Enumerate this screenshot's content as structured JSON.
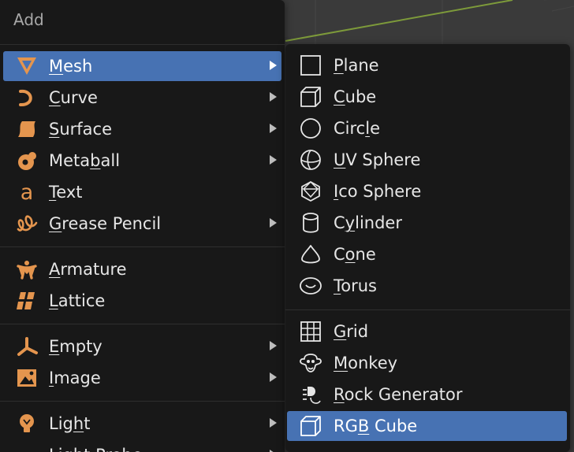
{
  "add_menu": {
    "title": "Add",
    "items": [
      {
        "label": "Mesh",
        "mnemonic": "M",
        "icon": "mesh-icon",
        "submenu": true,
        "active": true
      },
      {
        "label": "Curve",
        "mnemonic": "C",
        "icon": "curve-icon",
        "submenu": true
      },
      {
        "label": "Surface",
        "mnemonic": "S",
        "icon": "surface-icon",
        "submenu": true
      },
      {
        "label": "Metaball",
        "mnemonic": "b",
        "icon": "metaball-icon",
        "submenu": true
      },
      {
        "label": "Text",
        "mnemonic": "T",
        "icon": "text-icon",
        "submenu": false
      },
      {
        "label": "Grease Pencil",
        "mnemonic": "G",
        "icon": "grease-pencil-icon",
        "submenu": true
      },
      {
        "label": "Armature",
        "mnemonic": "A",
        "icon": "armature-icon",
        "submenu": false
      },
      {
        "label": "Lattice",
        "mnemonic": "L",
        "icon": "lattice-icon",
        "submenu": false
      },
      {
        "label": "Empty",
        "mnemonic": "E",
        "icon": "empty-icon",
        "submenu": true
      },
      {
        "label": "Image",
        "mnemonic": "I",
        "icon": "image-icon",
        "submenu": true
      },
      {
        "label": "Light",
        "mnemonic": "h",
        "icon": "light-icon",
        "submenu": true
      },
      {
        "label": "Light Probe",
        "mnemonic": "",
        "icon": "light-probe-icon",
        "submenu": true
      }
    ]
  },
  "mesh_menu": {
    "items": [
      {
        "label": "Plane",
        "mnemonic": "P",
        "icon": "plane-icon"
      },
      {
        "label": "Cube",
        "mnemonic": "C",
        "icon": "cube-icon"
      },
      {
        "label": "Circle",
        "mnemonic": "l",
        "icon": "circle-icon"
      },
      {
        "label": "UV Sphere",
        "mnemonic": "U",
        "icon": "uv-sphere-icon"
      },
      {
        "label": "Ico Sphere",
        "mnemonic": "I",
        "icon": "ico-sphere-icon"
      },
      {
        "label": "Cylinder",
        "mnemonic": "y",
        "icon": "cylinder-icon"
      },
      {
        "label": "Cone",
        "mnemonic": "o",
        "icon": "cone-icon"
      },
      {
        "label": "Torus",
        "mnemonic": "T",
        "icon": "torus-icon"
      },
      {
        "label": "Grid",
        "mnemonic": "G",
        "icon": "grid-icon"
      },
      {
        "label": "Monkey",
        "mnemonic": "M",
        "icon": "monkey-icon"
      },
      {
        "label": "Rock Generator",
        "mnemonic": "R",
        "icon": "rock-generator-icon"
      },
      {
        "label": "RGB Cube",
        "mnemonic": "B",
        "icon": "rgb-cube-icon",
        "active": true
      }
    ]
  },
  "colors": {
    "menu_bg": "#181818",
    "highlight": "#4772b3",
    "icon_orange": "#e4954e",
    "icon_white": "#e6e6e6",
    "viewport_bg": "#3a3a3a",
    "grid_line_green": "#7d9a3a"
  }
}
